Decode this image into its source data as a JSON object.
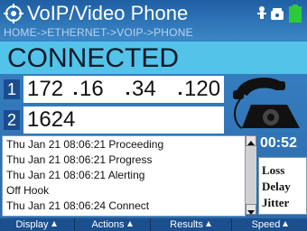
{
  "window": {
    "title": "VoIP/Video Phone",
    "breadcrumb": "HOME->ETHERNET->VOIP->PHONE",
    "title_icon": "gear-icon",
    "status_icons": [
      "person-icon",
      "phone-status-icon",
      "battery-icon"
    ]
  },
  "call": {
    "status": "CONNECTED",
    "ip_row_number": "1",
    "ip": [
      "172",
      "16",
      "34",
      "120"
    ],
    "port_row_number": "2",
    "port": "1624",
    "timer": "00:52"
  },
  "log": {
    "lines": [
      "Thu Jan 21 08:06:21 Proceeding",
      "Thu Jan 21 08:06:21 Progress",
      "Thu Jan 21 08:06:21 Alerting",
      "Off Hook",
      "Thu Jan 21 08:06:24 Connect"
    ]
  },
  "quality": {
    "items": [
      "Loss",
      "Delay",
      "Jitter"
    ]
  },
  "softkeys": {
    "display": "Display",
    "actions": "Actions",
    "results": "Results",
    "speed": "Speed"
  },
  "colors": {
    "title_bg": "#1f5fa3",
    "status_bg": "#53c3ea",
    "panel_bg": "#2f74b8",
    "softkey_bg": "#1b4f8e"
  }
}
